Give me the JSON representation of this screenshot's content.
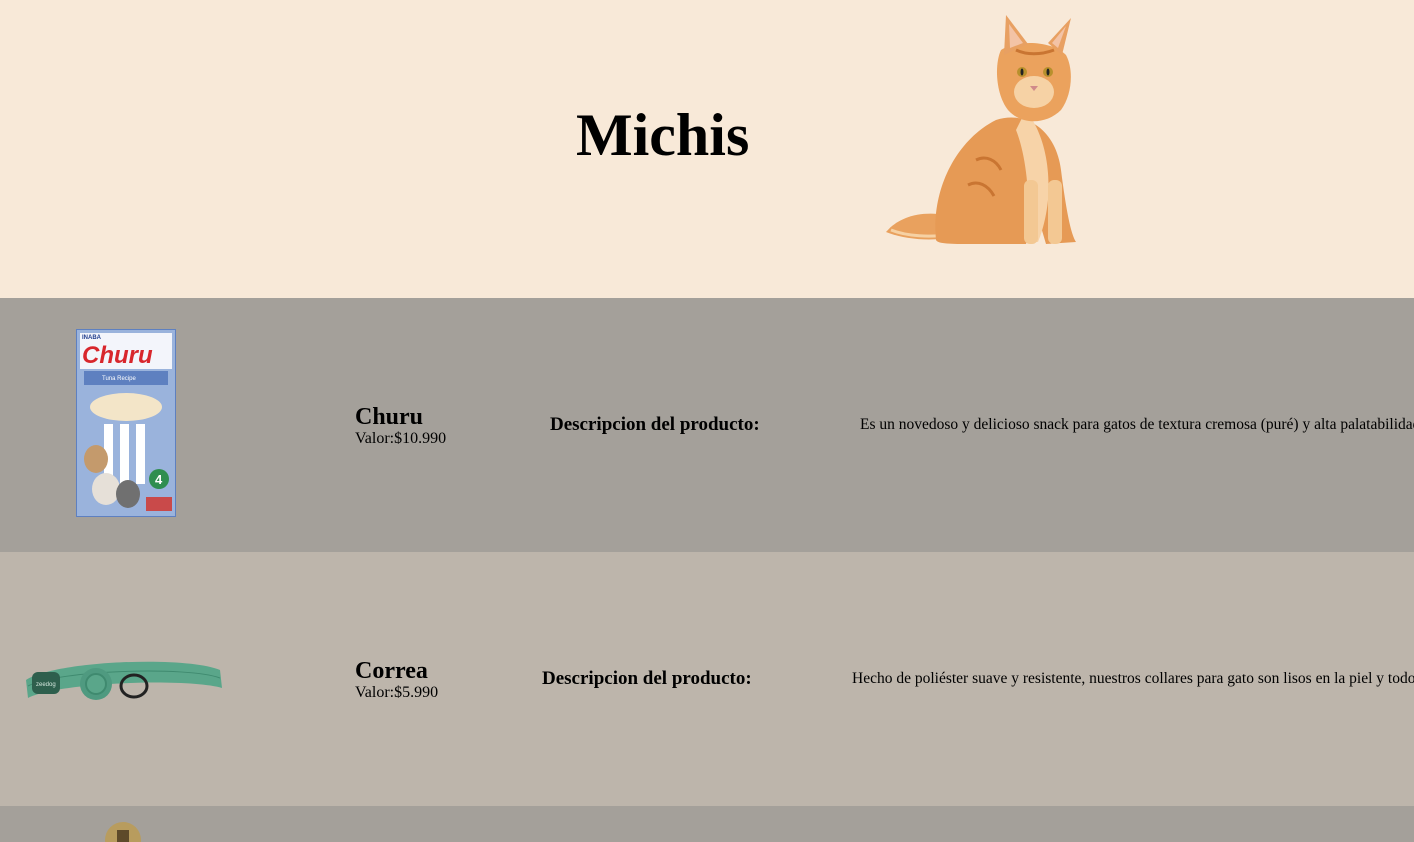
{
  "header": {
    "title": "Michis"
  },
  "products": [
    {
      "name": "Churu",
      "price": "Valor:$10.990",
      "desc_label": "Descripcion del producto:",
      "description": "Es un novedoso y delicioso snack para gatos de textura cremosa (puré) y alta palatabilidad",
      "image_brand": "Churu",
      "image_subtitle": "Tuna Recipe",
      "image_count": "4"
    },
    {
      "name": "Correa",
      "price": "Valor:$5.990",
      "desc_label": "Descripcion del producto:",
      "description": "Hecho de poliéster suave y resistente, nuestros collares para gato son lisos en la piel y todo"
    }
  ],
  "colors": {
    "header_bg": "#f8e9d8",
    "row_dark": "#a4a09a",
    "row_light": "#bdb5ab",
    "collar_green": "#5aa68a"
  }
}
